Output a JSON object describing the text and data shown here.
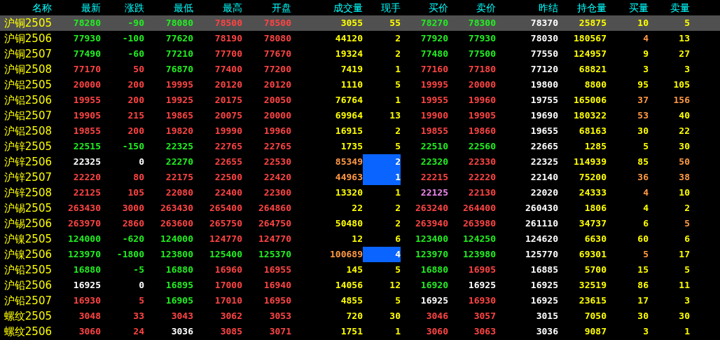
{
  "table": {
    "columns": [
      "名称",
      "最新",
      "涨跌",
      "最低",
      "最高",
      "开盘",
      "成交量",
      "现手",
      "买价",
      "卖价",
      "昨结",
      "持仓量",
      "买量",
      "卖量"
    ],
    "rows": [
      {
        "selected": true,
        "volume_highlighted": false,
        "cells": [
          {
            "text": "沪铜2505",
            "color": "#ffff00"
          },
          {
            "text": "78280",
            "color": "#22ee22"
          },
          {
            "text": "-90",
            "color": "#22ee22"
          },
          {
            "text": "78080",
            "color": "#22ee22"
          },
          {
            "text": "78500",
            "color": "#ff4444"
          },
          {
            "text": "78500",
            "color": "#ff4444"
          },
          {
            "text": "3055",
            "color": "#ffff00"
          },
          {
            "text": "55",
            "color": "#ffff00"
          },
          {
            "text": "78270",
            "color": "#22ee22"
          },
          {
            "text": "78300",
            "color": "#22ee22"
          },
          {
            "text": "78370",
            "color": "#ffffff"
          },
          {
            "text": "25875",
            "color": "#ffff00"
          },
          {
            "text": "10",
            "color": "#ffff00"
          },
          {
            "text": "5",
            "color": "#ffff00"
          }
        ]
      },
      {
        "selected": false,
        "volume_highlighted": false,
        "cells": [
          {
            "text": "沪铜2506",
            "color": "#ffff00"
          },
          {
            "text": "77930",
            "color": "#22ee22"
          },
          {
            "text": "-100",
            "color": "#22ee22"
          },
          {
            "text": "77620",
            "color": "#22ee22"
          },
          {
            "text": "78190",
            "color": "#ff4444"
          },
          {
            "text": "78080",
            "color": "#ff4444"
          },
          {
            "text": "44120",
            "color": "#ffff00"
          },
          {
            "text": "2",
            "color": "#ffff00"
          },
          {
            "text": "77920",
            "color": "#22ee22"
          },
          {
            "text": "77930",
            "color": "#22ee22"
          },
          {
            "text": "78030",
            "color": "#ffffff"
          },
          {
            "text": "180567",
            "color": "#ffff00"
          },
          {
            "text": "4",
            "color": "#ff9944"
          },
          {
            "text": "13",
            "color": "#ffff00"
          }
        ]
      },
      {
        "selected": false,
        "volume_highlighted": false,
        "cells": [
          {
            "text": "沪铜2507",
            "color": "#ffff00"
          },
          {
            "text": "77490",
            "color": "#22ee22"
          },
          {
            "text": "-60",
            "color": "#22ee22"
          },
          {
            "text": "77210",
            "color": "#22ee22"
          },
          {
            "text": "77700",
            "color": "#ff4444"
          },
          {
            "text": "77670",
            "color": "#ff4444"
          },
          {
            "text": "19324",
            "color": "#ffff00"
          },
          {
            "text": "2",
            "color": "#ffff00"
          },
          {
            "text": "77480",
            "color": "#22ee22"
          },
          {
            "text": "77500",
            "color": "#22ee22"
          },
          {
            "text": "77550",
            "color": "#ffffff"
          },
          {
            "text": "124957",
            "color": "#ffff00"
          },
          {
            "text": "9",
            "color": "#ffff00"
          },
          {
            "text": "27",
            "color": "#ffff00"
          }
        ]
      },
      {
        "selected": false,
        "volume_highlighted": false,
        "cells": [
          {
            "text": "沪铜2508",
            "color": "#ffff00"
          },
          {
            "text": "77170",
            "color": "#ff4444"
          },
          {
            "text": "50",
            "color": "#ff4444"
          },
          {
            "text": "76870",
            "color": "#22ee22"
          },
          {
            "text": "77400",
            "color": "#ff4444"
          },
          {
            "text": "77200",
            "color": "#ff4444"
          },
          {
            "text": "7419",
            "color": "#ffff00"
          },
          {
            "text": "1",
            "color": "#ffff00"
          },
          {
            "text": "77160",
            "color": "#ff4444"
          },
          {
            "text": "77180",
            "color": "#ff4444"
          },
          {
            "text": "77120",
            "color": "#ffffff"
          },
          {
            "text": "68821",
            "color": "#ffff00"
          },
          {
            "text": "3",
            "color": "#ffff00"
          },
          {
            "text": "3",
            "color": "#ffff00"
          }
        ]
      },
      {
        "selected": false,
        "volume_highlighted": false,
        "cells": [
          {
            "text": "沪铝2505",
            "color": "#ffff00"
          },
          {
            "text": "20000",
            "color": "#ff4444"
          },
          {
            "text": "200",
            "color": "#ff4444"
          },
          {
            "text": "19995",
            "color": "#ff4444"
          },
          {
            "text": "20120",
            "color": "#ff4444"
          },
          {
            "text": "20120",
            "color": "#ff4444"
          },
          {
            "text": "1110",
            "color": "#ffff00"
          },
          {
            "text": "5",
            "color": "#ffff00"
          },
          {
            "text": "19995",
            "color": "#ff4444"
          },
          {
            "text": "20000",
            "color": "#ff4444"
          },
          {
            "text": "19800",
            "color": "#ffffff"
          },
          {
            "text": "8800",
            "color": "#ffff00"
          },
          {
            "text": "95",
            "color": "#ffff00"
          },
          {
            "text": "105",
            "color": "#ffff00"
          }
        ]
      },
      {
        "selected": false,
        "volume_highlighted": false,
        "cells": [
          {
            "text": "沪铝2506",
            "color": "#ffff00"
          },
          {
            "text": "19955",
            "color": "#ff4444"
          },
          {
            "text": "200",
            "color": "#ff4444"
          },
          {
            "text": "19925",
            "color": "#ff4444"
          },
          {
            "text": "20175",
            "color": "#ff4444"
          },
          {
            "text": "20050",
            "color": "#ff4444"
          },
          {
            "text": "76764",
            "color": "#ffff00"
          },
          {
            "text": "1",
            "color": "#ffff00"
          },
          {
            "text": "19955",
            "color": "#ff4444"
          },
          {
            "text": "19960",
            "color": "#ff4444"
          },
          {
            "text": "19755",
            "color": "#ffffff"
          },
          {
            "text": "165006",
            "color": "#ffff00"
          },
          {
            "text": "37",
            "color": "#ff9944"
          },
          {
            "text": "156",
            "color": "#ff9944"
          }
        ]
      },
      {
        "selected": false,
        "volume_highlighted": false,
        "cells": [
          {
            "text": "沪铝2507",
            "color": "#ffff00"
          },
          {
            "text": "19905",
            "color": "#ff4444"
          },
          {
            "text": "215",
            "color": "#ff4444"
          },
          {
            "text": "19865",
            "color": "#ff4444"
          },
          {
            "text": "20075",
            "color": "#ff4444"
          },
          {
            "text": "20000",
            "color": "#ff4444"
          },
          {
            "text": "69964",
            "color": "#ffff00"
          },
          {
            "text": "13",
            "color": "#ffff00"
          },
          {
            "text": "19900",
            "color": "#ff4444"
          },
          {
            "text": "19905",
            "color": "#ff4444"
          },
          {
            "text": "19690",
            "color": "#ffffff"
          },
          {
            "text": "180322",
            "color": "#ffff00"
          },
          {
            "text": "53",
            "color": "#ff9944"
          },
          {
            "text": "40",
            "color": "#ffff00"
          }
        ]
      },
      {
        "selected": false,
        "volume_highlighted": false,
        "cells": [
          {
            "text": "沪铝2508",
            "color": "#ffff00"
          },
          {
            "text": "19855",
            "color": "#ff4444"
          },
          {
            "text": "200",
            "color": "#ff4444"
          },
          {
            "text": "19820",
            "color": "#ff4444"
          },
          {
            "text": "19990",
            "color": "#ff4444"
          },
          {
            "text": "19960",
            "color": "#ff4444"
          },
          {
            "text": "16915",
            "color": "#ffff00"
          },
          {
            "text": "2",
            "color": "#ffff00"
          },
          {
            "text": "19855",
            "color": "#ff4444"
          },
          {
            "text": "19860",
            "color": "#ff4444"
          },
          {
            "text": "19655",
            "color": "#ffffff"
          },
          {
            "text": "68163",
            "color": "#ffff00"
          },
          {
            "text": "30",
            "color": "#ffff00"
          },
          {
            "text": "22",
            "color": "#ffff00"
          }
        ]
      },
      {
        "selected": false,
        "volume_highlighted": false,
        "cells": [
          {
            "text": "沪锌2505",
            "color": "#ffff00"
          },
          {
            "text": "22515",
            "color": "#22ee22"
          },
          {
            "text": "-150",
            "color": "#22ee22"
          },
          {
            "text": "22325",
            "color": "#22ee22"
          },
          {
            "text": "22765",
            "color": "#ff4444"
          },
          {
            "text": "22765",
            "color": "#ff4444"
          },
          {
            "text": "1735",
            "color": "#ffff00"
          },
          {
            "text": "5",
            "color": "#ffff00"
          },
          {
            "text": "22510",
            "color": "#22ee22"
          },
          {
            "text": "22560",
            "color": "#22ee22"
          },
          {
            "text": "22665",
            "color": "#ffffff"
          },
          {
            "text": "1285",
            "color": "#ffff00"
          },
          {
            "text": "5",
            "color": "#ffff00"
          },
          {
            "text": "30",
            "color": "#ffff00"
          }
        ]
      },
      {
        "selected": false,
        "volume_highlighted": true,
        "cells": [
          {
            "text": "沪锌2506",
            "color": "#ffff00"
          },
          {
            "text": "22325",
            "color": "#ffffff"
          },
          {
            "text": "0",
            "color": "#ffffff"
          },
          {
            "text": "22270",
            "color": "#22ee22"
          },
          {
            "text": "22655",
            "color": "#ff4444"
          },
          {
            "text": "22530",
            "color": "#ff4444"
          },
          {
            "text": "85349",
            "color": "#ff9944"
          },
          {
            "text": "2",
            "color": "#ffffff"
          },
          {
            "text": "22320",
            "color": "#22ee22"
          },
          {
            "text": "22330",
            "color": "#ff4444"
          },
          {
            "text": "22325",
            "color": "#ffffff"
          },
          {
            "text": "114939",
            "color": "#ffff00"
          },
          {
            "text": "85",
            "color": "#ffff00"
          },
          {
            "text": "50",
            "color": "#ff9944"
          }
        ]
      },
      {
        "selected": false,
        "volume_highlighted": true,
        "cells": [
          {
            "text": "沪锌2507",
            "color": "#ffff00"
          },
          {
            "text": "22220",
            "color": "#ff4444"
          },
          {
            "text": "80",
            "color": "#ff4444"
          },
          {
            "text": "22175",
            "color": "#ff4444"
          },
          {
            "text": "22500",
            "color": "#ff4444"
          },
          {
            "text": "22420",
            "color": "#ff4444"
          },
          {
            "text": "44963",
            "color": "#ff9944"
          },
          {
            "text": "1",
            "color": "#ffffff"
          },
          {
            "text": "22215",
            "color": "#ff4444"
          },
          {
            "text": "22220",
            "color": "#ff4444"
          },
          {
            "text": "22140",
            "color": "#ffffff"
          },
          {
            "text": "75200",
            "color": "#ffff00"
          },
          {
            "text": "36",
            "color": "#ff9944"
          },
          {
            "text": "38",
            "color": "#ff9944"
          }
        ]
      },
      {
        "selected": false,
        "volume_highlighted": false,
        "cells": [
          {
            "text": "沪锌2508",
            "color": "#ffff00"
          },
          {
            "text": "22125",
            "color": "#ff4444"
          },
          {
            "text": "105",
            "color": "#ff4444"
          },
          {
            "text": "22080",
            "color": "#ff4444"
          },
          {
            "text": "22400",
            "color": "#ff4444"
          },
          {
            "text": "22300",
            "color": "#ff4444"
          },
          {
            "text": "13320",
            "color": "#ffff00"
          },
          {
            "text": "1",
            "color": "#ffff00"
          },
          {
            "text": "22125",
            "color": "#ee88ee"
          },
          {
            "text": "22130",
            "color": "#ff4444"
          },
          {
            "text": "22020",
            "color": "#ffffff"
          },
          {
            "text": "24333",
            "color": "#ffff00"
          },
          {
            "text": "4",
            "color": "#ff9944"
          },
          {
            "text": "10",
            "color": "#ffff00"
          }
        ]
      },
      {
        "selected": false,
        "volume_highlighted": false,
        "cells": [
          {
            "text": "沪锡2505",
            "color": "#ffff00"
          },
          {
            "text": "263430",
            "color": "#ff4444"
          },
          {
            "text": "3000",
            "color": "#ff4444"
          },
          {
            "text": "263430",
            "color": "#ff4444"
          },
          {
            "text": "265400",
            "color": "#ff4444"
          },
          {
            "text": "264860",
            "color": "#ff4444"
          },
          {
            "text": "22",
            "color": "#ffff00"
          },
          {
            "text": "2",
            "color": "#ffff00"
          },
          {
            "text": "263240",
            "color": "#ff4444"
          },
          {
            "text": "264400",
            "color": "#ff4444"
          },
          {
            "text": "260430",
            "color": "#ffffff"
          },
          {
            "text": "1806",
            "color": "#ffff00"
          },
          {
            "text": "4",
            "color": "#ffff00"
          },
          {
            "text": "2",
            "color": "#ffff00"
          }
        ]
      },
      {
        "selected": false,
        "volume_highlighted": false,
        "cells": [
          {
            "text": "沪锡2506",
            "color": "#ffff00"
          },
          {
            "text": "263970",
            "color": "#ff4444"
          },
          {
            "text": "2860",
            "color": "#ff4444"
          },
          {
            "text": "263600",
            "color": "#ff4444"
          },
          {
            "text": "265750",
            "color": "#ff4444"
          },
          {
            "text": "264750",
            "color": "#ff4444"
          },
          {
            "text": "50480",
            "color": "#ffff00"
          },
          {
            "text": "2",
            "color": "#ffff00"
          },
          {
            "text": "263940",
            "color": "#ff4444"
          },
          {
            "text": "263980",
            "color": "#ff4444"
          },
          {
            "text": "261110",
            "color": "#ffffff"
          },
          {
            "text": "34737",
            "color": "#ffff00"
          },
          {
            "text": "6",
            "color": "#ffff00"
          },
          {
            "text": "5",
            "color": "#ff9944"
          }
        ]
      },
      {
        "selected": false,
        "volume_highlighted": false,
        "cells": [
          {
            "text": "沪镍2505",
            "color": "#ffff00"
          },
          {
            "text": "124000",
            "color": "#22ee22"
          },
          {
            "text": "-620",
            "color": "#22ee22"
          },
          {
            "text": "124000",
            "color": "#22ee22"
          },
          {
            "text": "124770",
            "color": "#ff4444"
          },
          {
            "text": "124770",
            "color": "#ff4444"
          },
          {
            "text": "12",
            "color": "#ffff00"
          },
          {
            "text": "6",
            "color": "#ffff00"
          },
          {
            "text": "123400",
            "color": "#22ee22"
          },
          {
            "text": "124250",
            "color": "#22ee22"
          },
          {
            "text": "124620",
            "color": "#ffffff"
          },
          {
            "text": "6630",
            "color": "#ffff00"
          },
          {
            "text": "60",
            "color": "#ffff00"
          },
          {
            "text": "6",
            "color": "#ffff00"
          }
        ]
      },
      {
        "selected": false,
        "volume_highlighted": true,
        "cells": [
          {
            "text": "沪镍2506",
            "color": "#ffff00"
          },
          {
            "text": "123970",
            "color": "#22ee22"
          },
          {
            "text": "-1800",
            "color": "#22ee22"
          },
          {
            "text": "123800",
            "color": "#22ee22"
          },
          {
            "text": "125400",
            "color": "#22ee22"
          },
          {
            "text": "125370",
            "color": "#22ee22"
          },
          {
            "text": "100689",
            "color": "#ff9944"
          },
          {
            "text": "4",
            "color": "#ffffff"
          },
          {
            "text": "123970",
            "color": "#22ee22"
          },
          {
            "text": "123980",
            "color": "#22ee22"
          },
          {
            "text": "125770",
            "color": "#ffffff"
          },
          {
            "text": "69301",
            "color": "#ffff00"
          },
          {
            "text": "5",
            "color": "#ff9944"
          },
          {
            "text": "17",
            "color": "#ffff00"
          }
        ]
      },
      {
        "selected": false,
        "volume_highlighted": false,
        "cells": [
          {
            "text": "沪铅2505",
            "color": "#ffff00"
          },
          {
            "text": "16880",
            "color": "#22ee22"
          },
          {
            "text": "-5",
            "color": "#22ee22"
          },
          {
            "text": "16880",
            "color": "#22ee22"
          },
          {
            "text": "16960",
            "color": "#ff4444"
          },
          {
            "text": "16955",
            "color": "#ff4444"
          },
          {
            "text": "145",
            "color": "#ffff00"
          },
          {
            "text": "5",
            "color": "#ffff00"
          },
          {
            "text": "16880",
            "color": "#22ee22"
          },
          {
            "text": "16905",
            "color": "#ff4444"
          },
          {
            "text": "16885",
            "color": "#ffffff"
          },
          {
            "text": "5700",
            "color": "#ffff00"
          },
          {
            "text": "15",
            "color": "#ffff00"
          },
          {
            "text": "5",
            "color": "#ffff00"
          }
        ]
      },
      {
        "selected": false,
        "volume_highlighted": false,
        "cells": [
          {
            "text": "沪铅2506",
            "color": "#ffff00"
          },
          {
            "text": "16925",
            "color": "#ffffff"
          },
          {
            "text": "0",
            "color": "#ffffff"
          },
          {
            "text": "16895",
            "color": "#22ee22"
          },
          {
            "text": "17000",
            "color": "#ff4444"
          },
          {
            "text": "16940",
            "color": "#ff4444"
          },
          {
            "text": "14056",
            "color": "#ffff00"
          },
          {
            "text": "12",
            "color": "#ffff00"
          },
          {
            "text": "16920",
            "color": "#22ee22"
          },
          {
            "text": "16925",
            "color": "#ffffff"
          },
          {
            "text": "16925",
            "color": "#ffffff"
          },
          {
            "text": "32519",
            "color": "#ffff00"
          },
          {
            "text": "86",
            "color": "#ffff00"
          },
          {
            "text": "11",
            "color": "#ffff00"
          }
        ]
      },
      {
        "selected": false,
        "volume_highlighted": false,
        "cells": [
          {
            "text": "沪铅2507",
            "color": "#ffff00"
          },
          {
            "text": "16930",
            "color": "#ff4444"
          },
          {
            "text": "5",
            "color": "#ff4444"
          },
          {
            "text": "16905",
            "color": "#22ee22"
          },
          {
            "text": "17010",
            "color": "#ff4444"
          },
          {
            "text": "16950",
            "color": "#ff4444"
          },
          {
            "text": "4855",
            "color": "#ffff00"
          },
          {
            "text": "5",
            "color": "#ffff00"
          },
          {
            "text": "16925",
            "color": "#ffffff"
          },
          {
            "text": "16930",
            "color": "#ff4444"
          },
          {
            "text": "16925",
            "color": "#ffffff"
          },
          {
            "text": "23615",
            "color": "#ffff00"
          },
          {
            "text": "17",
            "color": "#ffff00"
          },
          {
            "text": "3",
            "color": "#ffff00"
          }
        ]
      },
      {
        "selected": false,
        "volume_highlighted": false,
        "cells": [
          {
            "text": "螺纹2505",
            "color": "#ffff00"
          },
          {
            "text": "3048",
            "color": "#ff4444"
          },
          {
            "text": "33",
            "color": "#ff4444"
          },
          {
            "text": "3043",
            "color": "#ff4444"
          },
          {
            "text": "3062",
            "color": "#ff4444"
          },
          {
            "text": "3053",
            "color": "#ff4444"
          },
          {
            "text": "720",
            "color": "#ffff00"
          },
          {
            "text": "30",
            "color": "#ffff00"
          },
          {
            "text": "3046",
            "color": "#ff4444"
          },
          {
            "text": "3057",
            "color": "#ff4444"
          },
          {
            "text": "3015",
            "color": "#ffffff"
          },
          {
            "text": "7050",
            "color": "#ffff00"
          },
          {
            "text": "30",
            "color": "#ffff00"
          },
          {
            "text": "30",
            "color": "#ffff00"
          }
        ]
      },
      {
        "selected": false,
        "volume_highlighted": false,
        "cells": [
          {
            "text": "螺纹2506",
            "color": "#ffff00"
          },
          {
            "text": "3060",
            "color": "#ff4444"
          },
          {
            "text": "24",
            "color": "#ff4444"
          },
          {
            "text": "3036",
            "color": "#ffffff"
          },
          {
            "text": "3085",
            "color": "#ff4444"
          },
          {
            "text": "3071",
            "color": "#ff4444"
          },
          {
            "text": "1751",
            "color": "#ffff00"
          },
          {
            "text": "1",
            "color": "#ffff00"
          },
          {
            "text": "3060",
            "color": "#ff4444"
          },
          {
            "text": "3063",
            "color": "#ff4444"
          },
          {
            "text": "3036",
            "color": "#ffffff"
          },
          {
            "text": "9087",
            "color": "#ffff00"
          },
          {
            "text": "3",
            "color": "#ffff00"
          },
          {
            "text": "1",
            "color": "#ffff00"
          }
        ]
      }
    ]
  }
}
